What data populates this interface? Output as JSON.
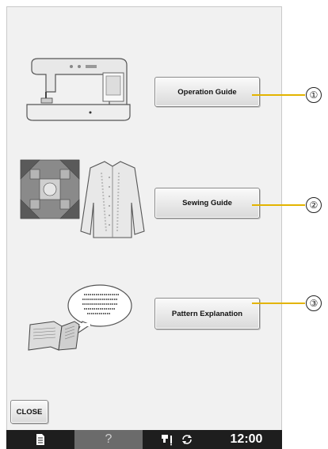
{
  "buttons": {
    "operation_guide": "Operation Guide",
    "sewing_guide": "Sewing Guide",
    "pattern_explanation": "Pattern Explanation",
    "close": "CLOSE"
  },
  "callouts": [
    "①",
    "②",
    "③"
  ],
  "status_bar": {
    "time": "12:00",
    "help_symbol": "?",
    "icons": [
      "document-icon",
      "help-icon",
      "needle-mode-icon",
      "rotate-icon"
    ]
  },
  "colors": {
    "screen_bg": "#f1f1f1",
    "leader_line": "#e3b400",
    "status_bar_bg": "#1e1e1e",
    "help_cell_bg": "#6b6b6b"
  }
}
